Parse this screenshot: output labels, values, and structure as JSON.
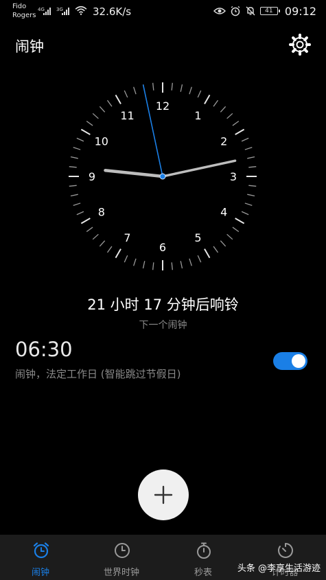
{
  "status_bar": {
    "carrier_line1": "Fido",
    "carrier_line2": "Rogers",
    "sim1_label": "4G",
    "sim2_label": "3G",
    "net_speed": "32.6K/s",
    "battery": "41",
    "time": "09:12",
    "icons": [
      "eye-icon",
      "alarm-clock-icon",
      "bell-off-icon",
      "battery-icon"
    ]
  },
  "header": {
    "title": "闹钟",
    "settings_icon": "gear-icon"
  },
  "clock": {
    "numerals": [
      "12",
      "1",
      "2",
      "3",
      "4",
      "5",
      "6",
      "7",
      "8",
      "9",
      "10",
      "11"
    ],
    "hour": 9,
    "minute": 12,
    "second": 58,
    "second_hand_color": "#1a7fe6"
  },
  "countdown_text": "21 小时 17 分钟后响铃",
  "next_alarm_label": "下一个闹钟",
  "alarm": {
    "time": "06:30",
    "description": "闹钟，法定工作日 (智能跳过节假日)",
    "enabled": true
  },
  "fab": {
    "icon": "plus-icon"
  },
  "nav": {
    "items": [
      {
        "label": "闹钟",
        "icon": "alarm-clock-icon",
        "active": true
      },
      {
        "label": "世界时钟",
        "icon": "clock-icon",
        "active": false
      },
      {
        "label": "秒表",
        "icon": "stopwatch-icon",
        "active": false
      },
      {
        "label": "计时器",
        "icon": "timer-icon",
        "active": false
      }
    ]
  },
  "watermark": "头条 @李享生活游迹",
  "colors": {
    "accent": "#1a7fe6",
    "background": "#000000",
    "nav_background": "#1c1c1c"
  }
}
